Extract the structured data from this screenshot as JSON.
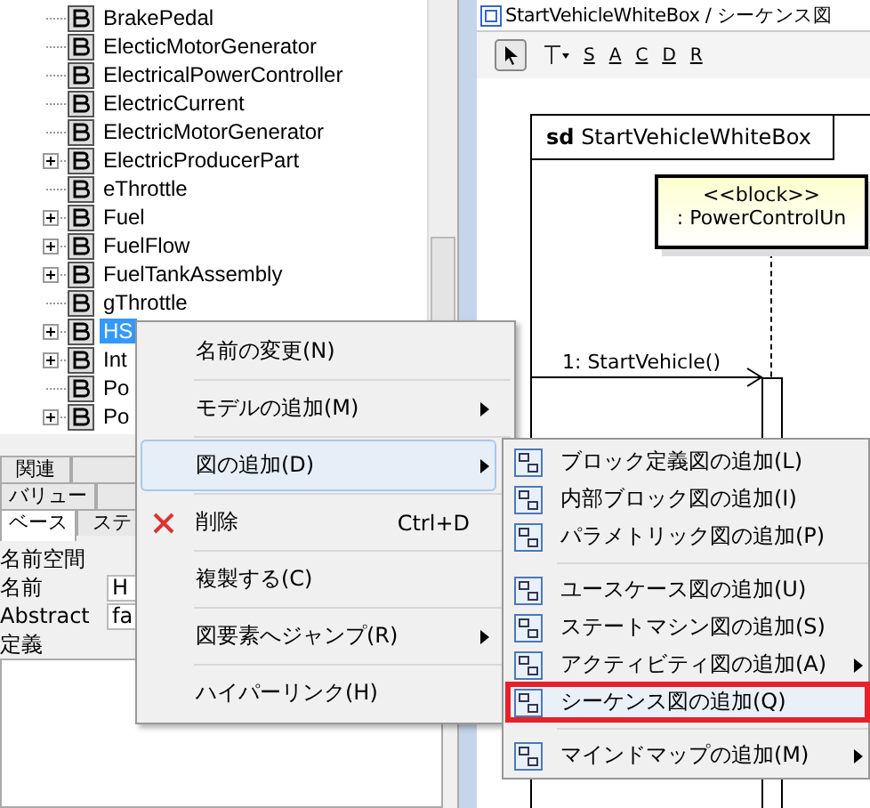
{
  "tree": {
    "items": [
      {
        "label": "BrakePedal",
        "expandable": false,
        "selected": false
      },
      {
        "label": "ElecticMotorGenerator",
        "expandable": false,
        "selected": false
      },
      {
        "label": "ElectricalPowerController",
        "expandable": false,
        "selected": false
      },
      {
        "label": "ElectricCurrent",
        "expandable": false,
        "selected": false
      },
      {
        "label": "ElectricMotorGenerator",
        "expandable": false,
        "selected": false
      },
      {
        "label": "ElectricProducerPart",
        "expandable": true,
        "selected": false
      },
      {
        "label": "eThrottle",
        "expandable": false,
        "selected": false
      },
      {
        "label": "Fuel",
        "expandable": true,
        "selected": false
      },
      {
        "label": "FuelFlow",
        "expandable": true,
        "selected": false
      },
      {
        "label": "FuelTankAssembly",
        "expandable": true,
        "selected": false
      },
      {
        "label": "gThrottle",
        "expandable": false,
        "selected": false
      },
      {
        "label": "HS",
        "expandable": true,
        "selected": true
      },
      {
        "label": "Int",
        "expandable": true,
        "selected": false
      },
      {
        "label": "Po",
        "expandable": false,
        "selected": false
      },
      {
        "label": "Po",
        "expandable": true,
        "selected": false
      }
    ]
  },
  "properties": {
    "tab_rows": [
      [
        {
          "label": "関連",
          "selected": false
        },
        {
          "selected": false
        }
      ],
      [
        {
          "label": "バリュー",
          "selected": false
        },
        {
          "selected": false
        }
      ],
      [
        {
          "label": "ベース",
          "selected": true
        },
        {
          "label": "ステ",
          "selected": false
        }
      ]
    ],
    "fields": [
      {
        "label": "名前空間"
      },
      {
        "label": "名前",
        "value": "H"
      },
      {
        "label": "Abstract",
        "value": "fa"
      },
      {
        "label": "定義"
      }
    ]
  },
  "editor": {
    "title": "StartVehicleWhiteBox / シーケンス図",
    "toolbar": [
      "S",
      "A",
      "C",
      "D",
      "R"
    ],
    "frame_label": "StartVehicleWhiteBox",
    "frame_kind": "sd",
    "lifeline": {
      "stereotype": "<<block>>",
      "name": ": PowerControlUn"
    },
    "message": "1: StartVehicle()"
  },
  "context_menu": {
    "items": [
      {
        "label": "名前の変更(N)",
        "submenu": false,
        "highlighted": false
      },
      {
        "label": "モデルの追加(M)",
        "submenu": true,
        "highlighted": false
      },
      {
        "label": "図の追加(D)",
        "submenu": true,
        "highlighted": true
      },
      {
        "label": "削除",
        "shortcut": "Ctrl+D",
        "kind": "delete",
        "submenu": false,
        "highlighted": false
      },
      {
        "label": "複製する(C)",
        "submenu": false,
        "highlighted": false
      },
      {
        "label": "図要素へジャンプ(R)",
        "submenu": true,
        "highlighted": false
      },
      {
        "label": "ハイパーリンク(H)",
        "submenu": false,
        "highlighted": false
      }
    ]
  },
  "submenu": {
    "groups": [
      [
        {
          "label": "ブロック定義図の追加(L)",
          "submenu": false,
          "marked": false
        },
        {
          "label": "内部ブロック図の追加(I)",
          "submenu": false,
          "marked": false
        },
        {
          "label": "パラメトリック図の追加(P)",
          "submenu": false,
          "marked": false
        }
      ],
      [
        {
          "label": "ユースケース図の追加(U)",
          "submenu": false,
          "marked": false
        },
        {
          "label": "ステートマシン図の追加(S)",
          "submenu": false,
          "marked": false
        },
        {
          "label": "アクティビティ図の追加(A)",
          "submenu": true,
          "marked": false
        },
        {
          "label": "シーケンス図の追加(Q)",
          "submenu": false,
          "marked": true
        }
      ],
      [
        {
          "label": "マインドマップの追加(M)",
          "submenu": true,
          "marked": false
        }
      ]
    ]
  }
}
